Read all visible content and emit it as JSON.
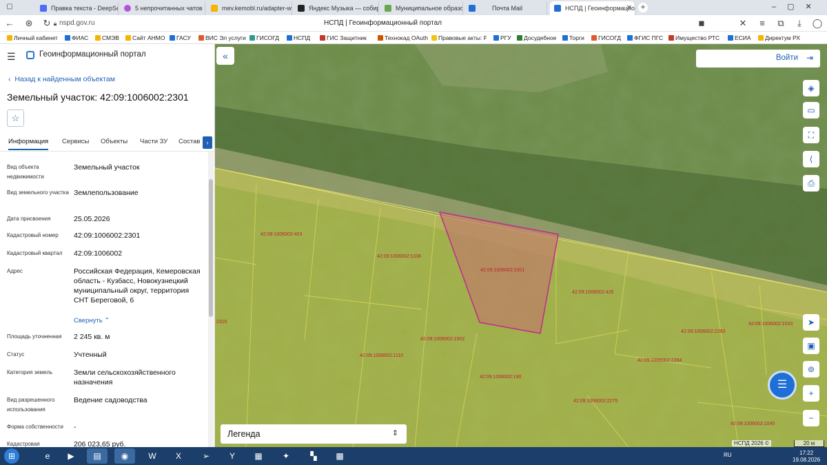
{
  "browser": {
    "tabs": [
      {
        "label": "Правка текста - DeepSee",
        "color": "#4a6cf7"
      },
      {
        "label": "5 непрочитанных чатов",
        "color": "#b455d9"
      },
      {
        "label": "mev.kemobl.ru/adapter-w",
        "color": "#f4b400"
      },
      {
        "label": "Яндекс Музыка — собир",
        "color": "#222222"
      },
      {
        "label": "Муниципальное образо",
        "color": "#6aa84f"
      },
      {
        "label": "Почта Mail",
        "color": "#1f6fd6"
      },
      {
        "label": "НСПД | Геоинформацио",
        "color": "#1f6fd6"
      }
    ],
    "url": "nspd.gov.ru",
    "page_title": "НСПД | Геоинформационный портал",
    "bookmarks": [
      "Личный кабинет",
      "ФИАС",
      "СМЭВ",
      "Сайт АНМО",
      "ГАСУ",
      "ВИС Эл услуги",
      "ГИСОГД",
      "НСПД",
      "ГИС Защитник",
      "Технокад OAuth",
      "Правовые акты: Р",
      "РГУ",
      "Досудебное",
      "Торги",
      "ГИСОГД",
      "ФГИС ПГС",
      "Имущество РТС",
      "ЕСИА",
      "Директум РХ"
    ]
  },
  "sidebar": {
    "app_title": "Геоинформационный портал",
    "back_label": "Назад к найденным объектам",
    "object_title": "Земельный участок: 42:09:1006002:2301",
    "tabs": [
      "Информация",
      "Сервисы",
      "Объекты",
      "Части ЗУ",
      "Состав"
    ],
    "properties": [
      {
        "label": "Вид объекта недвижимости",
        "value": "Земельный участок"
      },
      {
        "label": "Вид земельного участка",
        "value": "Землепользование"
      },
      {
        "label": "Дата присвоения",
        "value": "25.05.2026"
      },
      {
        "label": "Кадастровый номер",
        "value": "42:09:1006002:2301"
      },
      {
        "label": "Кадастровый квартал",
        "value": "42:09:1006002"
      },
      {
        "label": "Адрес",
        "value": "Российская Федерация, Кемеровская область - Кузбасс, Новокузнецкий муниципальный округ, территория СНТ Береговой, 6"
      },
      {
        "label": "Площадь уточненная",
        "value": "2 245 кв. м"
      },
      {
        "label": "Статус",
        "value": "Учтенный"
      },
      {
        "label": "Категория земель",
        "value": "Земли сельскохозяйственного назначения"
      },
      {
        "label": "Вид разрешенного использования",
        "value": "Ведение садоводства"
      },
      {
        "label": "Форма собственности",
        "value": "-"
      },
      {
        "label": "Кадастровая",
        "value": "206 023,65 руб."
      }
    ],
    "collapse_label": "Свернуть"
  },
  "map": {
    "login_label": "Войти",
    "legend_label": "Легенда",
    "copyright": "НСПД 2026 ©",
    "scale": "20 м",
    "parcel_labels": [
      "42:09:1006002:403",
      "42:09:1006002:1108",
      "42:09:1006002:2301",
      "42:09:1006002:426",
      "42:09:1006002:2302",
      "42:09:1006002:1110",
      "42:09:1006002:190",
      "42:09:1006002:2284",
      "42:09:1006002:2283",
      "42:09:1006002:2275",
      "42:09:1006002:1033",
      "42:09:1006002:1045",
      "2315"
    ],
    "highlight_color": "#c0308a"
  },
  "taskbar": {
    "lang": "RU",
    "time": "17:22",
    "date": "19.08.2026"
  }
}
